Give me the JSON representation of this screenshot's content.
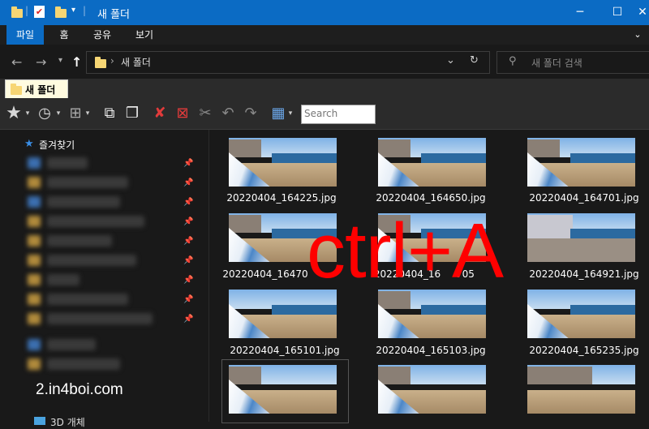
{
  "window": {
    "title": "새 폴더",
    "title_bar_color": "#0b6bc4"
  },
  "menu": {
    "items": [
      "파일",
      "홈",
      "공유",
      "보기"
    ]
  },
  "address": {
    "path": "새 폴더"
  },
  "search": {
    "placeholder": "새 폴더 검색"
  },
  "tab": {
    "label": "새 폴더"
  },
  "toolbar": {
    "search_placeholder": "Search"
  },
  "sidebar": {
    "quick_access": "즐겨찾기",
    "bottom_item": "3D 개체"
  },
  "files": [
    {
      "name": "20220404_164225.jpg"
    },
    {
      "name": "20220404_164650.jpg"
    },
    {
      "name": "20220404_164701.jpg"
    },
    {
      "name": "20220404_16470"
    },
    {
      "name": "20220404_16"
    },
    {
      "name": "20220404_164921.jpg"
    },
    {
      "name": "20220404_165101.jpg"
    },
    {
      "name": "20220404_165103.jpg"
    },
    {
      "name": "20220404_165235.jpg"
    }
  ],
  "overlay_text": "ctrl+A",
  "overlay_color": "#ff0000",
  "overlay_name_fragment": "705",
  "watermark": "2.in4boi.com"
}
